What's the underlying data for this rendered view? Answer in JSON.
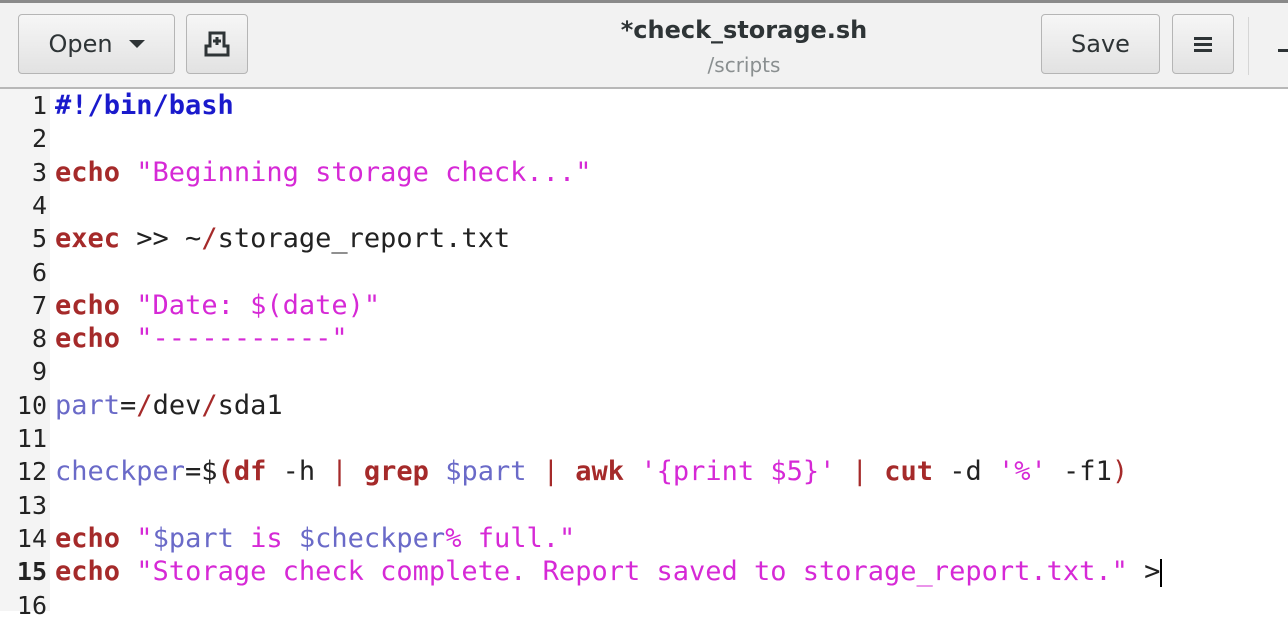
{
  "header": {
    "open_label": "Open",
    "title": "*check_storage.sh",
    "subtitle": "/scripts",
    "save_label": "Save",
    "icons": {
      "open_dropdown": "chevron-down-icon",
      "new_document": "new-document-icon",
      "menu": "hamburger-menu-icon"
    }
  },
  "colors": {
    "keyword": "#a52a2a",
    "string": "#d629d6",
    "variable": "#6a6ac8",
    "shebang": "#1a1acc"
  },
  "editor": {
    "current_line": 15,
    "lines": [
      {
        "num": "1",
        "tokens": [
          {
            "t": "#!/bin/bash",
            "c": "shebang"
          }
        ]
      },
      {
        "num": "2",
        "tokens": []
      },
      {
        "num": "3",
        "tokens": [
          {
            "t": "echo",
            "c": "kw"
          },
          {
            "t": " ",
            "c": "plain"
          },
          {
            "t": "\"Beginning storage check...\"",
            "c": "str"
          }
        ]
      },
      {
        "num": "4",
        "tokens": []
      },
      {
        "num": "5",
        "tokens": [
          {
            "t": "exec",
            "c": "kw"
          },
          {
            "t": " >> ~",
            "c": "plain"
          },
          {
            "t": "/",
            "c": "op"
          },
          {
            "t": "storage_report.txt",
            "c": "plain"
          }
        ]
      },
      {
        "num": "6",
        "tokens": []
      },
      {
        "num": "7",
        "tokens": [
          {
            "t": "echo",
            "c": "kw"
          },
          {
            "t": " ",
            "c": "plain"
          },
          {
            "t": "\"Date: $(date)\"",
            "c": "str"
          }
        ]
      },
      {
        "num": "8",
        "tokens": [
          {
            "t": "echo",
            "c": "kw"
          },
          {
            "t": " ",
            "c": "plain"
          },
          {
            "t": "\"-----------\"",
            "c": "str"
          }
        ]
      },
      {
        "num": "9",
        "tokens": []
      },
      {
        "num": "10",
        "tokens": [
          {
            "t": "part",
            "c": "var"
          },
          {
            "t": "=",
            "c": "plain"
          },
          {
            "t": "/",
            "c": "op"
          },
          {
            "t": "dev",
            "c": "plain"
          },
          {
            "t": "/",
            "c": "op"
          },
          {
            "t": "sda1",
            "c": "plain"
          }
        ]
      },
      {
        "num": "11",
        "tokens": []
      },
      {
        "num": "12",
        "tokens": [
          {
            "t": "checkper",
            "c": "var"
          },
          {
            "t": "=$",
            "c": "plain"
          },
          {
            "t": "(",
            "c": "kw"
          },
          {
            "t": "df",
            "c": "kw"
          },
          {
            "t": " -h ",
            "c": "plain"
          },
          {
            "t": "|",
            "c": "op"
          },
          {
            "t": " ",
            "c": "plain"
          },
          {
            "t": "grep",
            "c": "kw"
          },
          {
            "t": " ",
            "c": "plain"
          },
          {
            "t": "$part",
            "c": "var"
          },
          {
            "t": " ",
            "c": "plain"
          },
          {
            "t": "|",
            "c": "op"
          },
          {
            "t": " ",
            "c": "plain"
          },
          {
            "t": "awk",
            "c": "kw"
          },
          {
            "t": " ",
            "c": "plain"
          },
          {
            "t": "'{print $5}'",
            "c": "str"
          },
          {
            "t": " ",
            "c": "plain"
          },
          {
            "t": "|",
            "c": "op"
          },
          {
            "t": " ",
            "c": "plain"
          },
          {
            "t": "cut",
            "c": "kw"
          },
          {
            "t": " -d ",
            "c": "plain"
          },
          {
            "t": "'%'",
            "c": "str"
          },
          {
            "t": " -f1",
            "c": "plain"
          },
          {
            "t": ")",
            "c": "op"
          }
        ]
      },
      {
        "num": "13",
        "tokens": []
      },
      {
        "num": "14",
        "tokens": [
          {
            "t": "echo",
            "c": "kw"
          },
          {
            "t": " ",
            "c": "plain"
          },
          {
            "t": "\"",
            "c": "str"
          },
          {
            "t": "$part",
            "c": "var"
          },
          {
            "t": " is ",
            "c": "str"
          },
          {
            "t": "$checkper",
            "c": "var"
          },
          {
            "t": "% full.\"",
            "c": "str"
          }
        ]
      },
      {
        "num": "15",
        "tokens": [
          {
            "t": "echo",
            "c": "kw"
          },
          {
            "t": " ",
            "c": "plain"
          },
          {
            "t": "\"Storage check complete. Report saved to storage_report.txt.\"",
            "c": "str"
          },
          {
            "t": " >",
            "c": "plain"
          }
        ]
      },
      {
        "num": "16",
        "tokens": []
      }
    ]
  }
}
